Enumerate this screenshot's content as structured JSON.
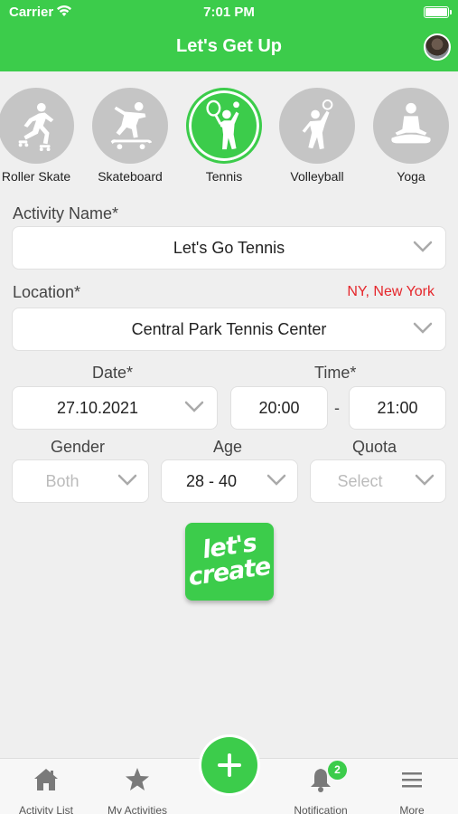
{
  "status_bar": {
    "carrier": "Carrier",
    "time": "7:01 PM"
  },
  "nav": {
    "title": "Let's Get Up"
  },
  "activities": [
    {
      "label": "Roller Skate",
      "icon": "roller-skate-icon",
      "selected": false
    },
    {
      "label": "Skateboard",
      "icon": "skateboard-icon",
      "selected": false
    },
    {
      "label": "Tennis",
      "icon": "tennis-icon",
      "selected": true
    },
    {
      "label": "Volleyball",
      "icon": "volleyball-icon",
      "selected": false
    },
    {
      "label": "Yoga",
      "icon": "yoga-icon",
      "selected": false
    }
  ],
  "form": {
    "activity_name_label": "Activity Name*",
    "activity_name_value": "Let's Go Tennis",
    "location_label": "Location*",
    "location_city": "NY, New York",
    "location_value": "Central Park Tennis Center",
    "date_label": "Date*",
    "date_value": "27.10.2021",
    "time_label": "Time*",
    "time_start": "20:00",
    "time_separator": "-",
    "time_end": "21:00",
    "gender_label": "Gender",
    "gender_value": "Both",
    "age_label": "Age",
    "age_value": "28 - 40",
    "quota_label": "Quota",
    "quota_value": "Select"
  },
  "create_button": {
    "line1": "let's",
    "line2": "create"
  },
  "tabbar": {
    "items": [
      {
        "label": "Activity List",
        "icon": "home-icon"
      },
      {
        "label": "My Activities",
        "icon": "star-icon"
      },
      {
        "label": "Notification",
        "icon": "bell-icon",
        "badge": "2"
      },
      {
        "label": "More",
        "icon": "menu-icon"
      }
    ],
    "fab_icon": "plus-icon"
  },
  "colors": {
    "accent": "#3ccc4b",
    "city_text": "#e5262b",
    "inactive_circle": "#c5c5c5"
  }
}
